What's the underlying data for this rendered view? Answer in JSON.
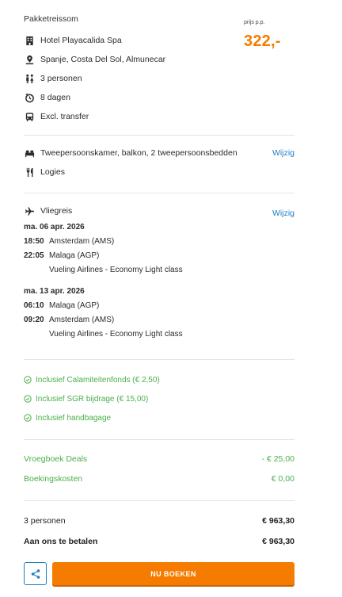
{
  "package": {
    "title": "Pakketreissom",
    "price_label": "prijs p.p.",
    "price": "322,-",
    "hotel": "Hotel Playacalida Spa",
    "location": "Spanje, Costa Del Sol, Almunecar",
    "persons": "3 personen",
    "duration": "8 dagen",
    "transfer": "Excl. transfer"
  },
  "room": {
    "type": "Tweepersoonskamer, balkon, 2 tweepersoonsbedden",
    "board": "Logies",
    "edit_label": "Wijzig"
  },
  "flight": {
    "title": "Vliegreis",
    "edit_label": "Wijzig",
    "outbound": {
      "date": "ma. 06 apr. 2026",
      "depart_time": "18:50",
      "depart_airport": "Amsterdam (AMS)",
      "arrive_time": "22:05",
      "arrive_airport": "Malaga (AGP)",
      "airline": "Vueling Airlines - Economy Light class"
    },
    "return": {
      "date": "ma. 13 apr. 2026",
      "depart_time": "06:10",
      "depart_airport": "Malaga (AGP)",
      "arrive_time": "09:20",
      "arrive_airport": "Amsterdam (AMS)",
      "airline": "Vueling Airlines - Economy Light class"
    }
  },
  "inclusions": [
    "Inclusief Calamiteitenfonds (€ 2,50)",
    "Inclusief SGR bijdrage (€ 15,00)",
    "Inclusief handbagage"
  ],
  "costs": {
    "early_booking_label": "Vroegboek Deals",
    "early_booking_value": "- € 25,00",
    "booking_fee_label": "Boekingskosten",
    "booking_fee_value": "€ 0,00"
  },
  "totals": {
    "persons_label": "3 personen",
    "persons_value": "€ 963,30",
    "pay_label": "Aan ons te betalen",
    "pay_value": "€ 963,30"
  },
  "actions": {
    "book_label": "NU BOEKEN"
  },
  "colors": {
    "accent_orange": "#f57c00",
    "link_blue": "#1c7fc4",
    "green": "#4cae4c"
  }
}
